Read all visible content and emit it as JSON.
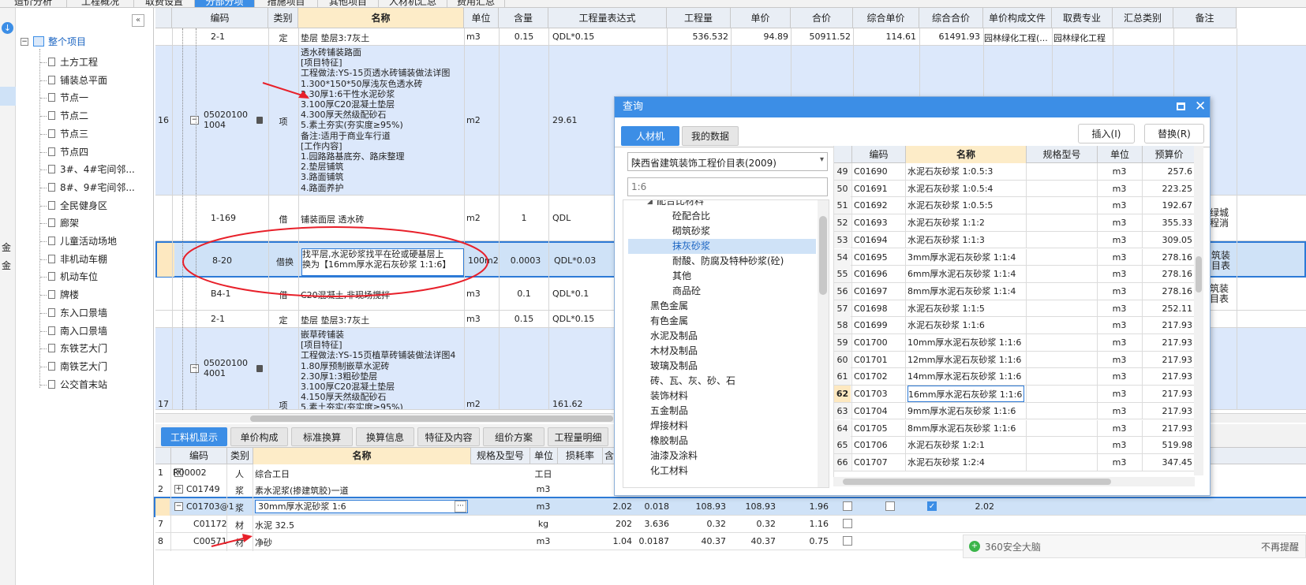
{
  "top_tabs": [
    "造价分析",
    "工程概况",
    "取费设置",
    "分部分项",
    "措施项目",
    "其他项目",
    "人材机汇总",
    "费用汇总"
  ],
  "left_strip": {
    "labels": [
      "金",
      "金"
    ]
  },
  "project_tree": {
    "root": "整个项目",
    "items": [
      "土方工程",
      "铺装总平面",
      "节点一",
      "节点二",
      "节点三",
      "节点四",
      "3#、4#宅间邻...",
      "8#、9#宅间邻...",
      "全民健身区",
      "廊架",
      "儿童活动场地",
      "非机动车棚",
      "机动车位",
      "牌楼",
      "东入口景墙",
      "南入口景墙",
      "东铁艺大门",
      "南铁艺大门",
      "公交首末站"
    ]
  },
  "grid": {
    "headers": [
      "编码",
      "类别",
      "名称",
      "单位",
      "含量",
      "工程量表达式",
      "工程量",
      "单价",
      "合价",
      "综合单价",
      "综合合价",
      "单价构成文件",
      "取费专业",
      "汇总类别",
      "备注"
    ],
    "rows": [
      {
        "num": "",
        "code": "2-1",
        "type": "定",
        "name": "垫层 垫层3:7灰土",
        "unit": "m3",
        "content": "0.15",
        "expr": "QDL*0.15",
        "qty": "536.532",
        "price": "94.89",
        "total": "50911.52",
        "unit_comp": "114.61",
        "total_comp": "61491.93",
        "file": "园林绿化工程(...",
        "major": "园林绿化工程",
        "cat": "",
        "note": ""
      },
      {
        "num": "16",
        "code": "050201001004",
        "type": "项",
        "name": "透水砖铺装路面\n[项目特征]\n工程做法:YS-15页透水砖铺装做法详图\n1.300*150*50厚浅灰色透水砖\n2.30厚1:6干性水泥砂浆\n3.100厚C20混凝土垫层\n4.300厚天然级配砂石\n5.素土夯实(夯实度≥95%)\n备注:适用于商业车行道\n[工作内容]\n1.园路路基底夯、路床整理\n2.垫层铺筑\n3.路面铺筑\n4.路面养护",
        "unit": "m2",
        "content": "",
        "expr": "29.61",
        "qty": "",
        "price": "",
        "total": "",
        "unit_comp": "",
        "total_comp": "",
        "file": "",
        "major": "",
        "cat": "",
        "note": ""
      },
      {
        "num": "",
        "code": "1-169",
        "type": "借",
        "name": "铺装面层 透水砖",
        "unit": "m2",
        "content": "1",
        "expr": "QDL",
        "note": "绿城\n程消"
      },
      {
        "num": "",
        "code": "8-20",
        "type": "借换",
        "name": "找平层,水泥砂浆找平在砼或硬基层上\n换为【16mm厚水泥石灰砂浆 1:1:6】",
        "unit": "100m2",
        "content": "0.0003",
        "expr": "QDL*0.03",
        "note": "筑装\n目表"
      },
      {
        "num": "",
        "code": "B4-1",
        "type": "借",
        "name": "C20混凝土,非现场搅拌",
        "unit": "m3",
        "content": "0.1",
        "expr": "QDL*0.1",
        "note": "筑装\n目表"
      },
      {
        "num": "",
        "code": "2-1",
        "type": "定",
        "name": "垫层 垫层3:7灰土",
        "unit": "m3",
        "content": "0.15",
        "expr": "QDL*0.15"
      },
      {
        "num": "17",
        "code": "050201004001",
        "type": "项",
        "name": "嵌草砖铺装\n[项目特征]\n工程做法:YS-15页植草砖铺装做法详图4\n1.80厚预制嵌草水泥砖\n2.30厚1:3粗砂垫层\n3.100厚C20混凝土垫层\n4.150厚天然级配砂石\n5.素土夯实(夯实度≥95%)",
        "unit": "m2",
        "content": "",
        "expr": "161.62"
      }
    ]
  },
  "bottom_tabs": [
    "工料机显示",
    "单价构成",
    "标准换算",
    "换算信息",
    "特征及内容",
    "组价方案",
    "工程量明细"
  ],
  "bottom_grid": {
    "headers": [
      "编码",
      "类别",
      "名称",
      "规格及型号",
      "单位",
      "损耗率",
      "含"
    ],
    "rows": [
      {
        "num": "1",
        "code": "R00002",
        "type": "人",
        "name": "综合工日",
        "unit": "工日",
        "a": "",
        "b": "",
        "c": "",
        "d": "",
        "e": "",
        "f": ""
      },
      {
        "num": "2",
        "code": "C01749",
        "type": "浆",
        "name": "素水泥浆(掺建筑胶)一道",
        "unit": "m3",
        "a": "",
        "b": "",
        "c": "",
        "d": "",
        "e": "",
        "f": ""
      },
      {
        "num": "6",
        "code": "C01703@1",
        "type": "浆",
        "name": "30mm厚水泥砂浆 1:6",
        "unit": "m3",
        "a": "2.02",
        "b": "0.018",
        "c": "108.93",
        "d": "108.93",
        "e": "1.96",
        "f": "2.02"
      },
      {
        "num": "7",
        "code": "C01172",
        "type": "材",
        "name": "水泥 32.5",
        "unit": "kg",
        "a": "202",
        "b": "3.636",
        "c": "0.32",
        "d": "0.32",
        "e": "1.16",
        "f": ""
      },
      {
        "num": "8",
        "code": "C00571",
        "type": "材",
        "name": "净砂",
        "unit": "m3",
        "a": "1.04",
        "b": "0.0187",
        "c": "40.37",
        "d": "40.37",
        "e": "0.75",
        "f": ""
      }
    ]
  },
  "dialog": {
    "title": "查询",
    "tabs": [
      "人材机",
      "我的数据"
    ],
    "btn_insert": "插入(I)",
    "btn_replace": "替换(R)",
    "library": "陕西省建筑装饰工程价目表(2009)",
    "search_placeholder": "1:6",
    "tree": [
      {
        "label": "配合比材料",
        "indent": 0,
        "expanded": true
      },
      {
        "label": "砼配合比",
        "indent": 1
      },
      {
        "label": "砌筑砂浆",
        "indent": 1
      },
      {
        "label": "抹灰砂浆",
        "indent": 1,
        "selected": true
      },
      {
        "label": "耐酸、防腐及特种砂浆(砼)",
        "indent": 1
      },
      {
        "label": "其他",
        "indent": 1
      },
      {
        "label": "商品砼",
        "indent": 1
      },
      {
        "label": "黑色金属",
        "indent": -1
      },
      {
        "label": "有色金属",
        "indent": -1
      },
      {
        "label": "水泥及制品",
        "indent": -1
      },
      {
        "label": "木材及制品",
        "indent": -1
      },
      {
        "label": "玻璃及制品",
        "indent": -1
      },
      {
        "label": "砖、瓦、灰、砂、石",
        "indent": -1
      },
      {
        "label": "装饰材料",
        "indent": -1
      },
      {
        "label": "五金制品",
        "indent": -1
      },
      {
        "label": "焊接材料",
        "indent": -1
      },
      {
        "label": "橡胶制品",
        "indent": -1
      },
      {
        "label": "油漆及涂料",
        "indent": -1
      },
      {
        "label": "化工材料",
        "indent": -1
      }
    ],
    "mat_headers": [
      "编码",
      "名称",
      "规格型号",
      "单位",
      "预算价"
    ],
    "materials": [
      {
        "num": "49",
        "code": "C01690",
        "name": "水泥石灰砂浆 1:0.5:3",
        "unit": "m3",
        "price": "257.6"
      },
      {
        "num": "50",
        "code": "C01691",
        "name": "水泥石灰砂浆 1:0.5:4",
        "unit": "m3",
        "price": "223.25"
      },
      {
        "num": "51",
        "code": "C01692",
        "name": "水泥石灰砂浆 1:0.5:5",
        "unit": "m3",
        "price": "192.67"
      },
      {
        "num": "52",
        "code": "C01693",
        "name": "水泥石灰砂浆 1:1:2",
        "unit": "m3",
        "price": "355.33"
      },
      {
        "num": "53",
        "code": "C01694",
        "name": "水泥石灰砂浆 1:1:3",
        "unit": "m3",
        "price": "309.05"
      },
      {
        "num": "54",
        "code": "C01695",
        "name": "3mm厚水泥石灰砂浆 1:1:4",
        "unit": "m3",
        "price": "278.16"
      },
      {
        "num": "55",
        "code": "C01696",
        "name": "6mm厚水泥石灰砂浆 1:1:4",
        "unit": "m3",
        "price": "278.16"
      },
      {
        "num": "56",
        "code": "C01697",
        "name": "8mm厚水泥石灰砂浆 1:1:4",
        "unit": "m3",
        "price": "278.16"
      },
      {
        "num": "57",
        "code": "C01698",
        "name": "水泥石灰砂浆 1:1:5",
        "unit": "m3",
        "price": "252.11"
      },
      {
        "num": "58",
        "code": "C01699",
        "name": "水泥石灰砂浆 1:1:6",
        "unit": "m3",
        "price": "217.93"
      },
      {
        "num": "59",
        "code": "C01700",
        "name": "10mm厚水泥石灰砂浆 1:1:6",
        "unit": "m3",
        "price": "217.93"
      },
      {
        "num": "60",
        "code": "C01701",
        "name": "12mm厚水泥石灰砂浆 1:1:6",
        "unit": "m3",
        "price": "217.93"
      },
      {
        "num": "61",
        "code": "C01702",
        "name": "14mm厚水泥石灰砂浆 1:1:6",
        "unit": "m3",
        "price": "217.93"
      },
      {
        "num": "62",
        "code": "C01703",
        "name": "16mm厚水泥石灰砂浆 1:1:6",
        "unit": "m3",
        "price": "217.93",
        "selected": true
      },
      {
        "num": "63",
        "code": "C01704",
        "name": "9mm厚水泥石灰砂浆 1:1:6",
        "unit": "m3",
        "price": "217.93"
      },
      {
        "num": "64",
        "code": "C01705",
        "name": "8mm厚水泥石灰砂浆 1:1:6",
        "unit": "m3",
        "price": "217.93"
      },
      {
        "num": "65",
        "code": "C01706",
        "name": "水泥石灰砂浆 1:2:1",
        "unit": "m3",
        "price": "519.98"
      },
      {
        "num": "66",
        "code": "C01707",
        "name": "水泥石灰砂浆 1:2:4",
        "unit": "m3",
        "price": "347.45"
      }
    ]
  },
  "notification": {
    "app": "360安全大脑",
    "action": "不再提醒"
  },
  "colors": {
    "accent": "#3c8ee6",
    "annotation": "#e8202a",
    "selected_row": "#cfe2f7",
    "header_name": "#fdecc8"
  }
}
